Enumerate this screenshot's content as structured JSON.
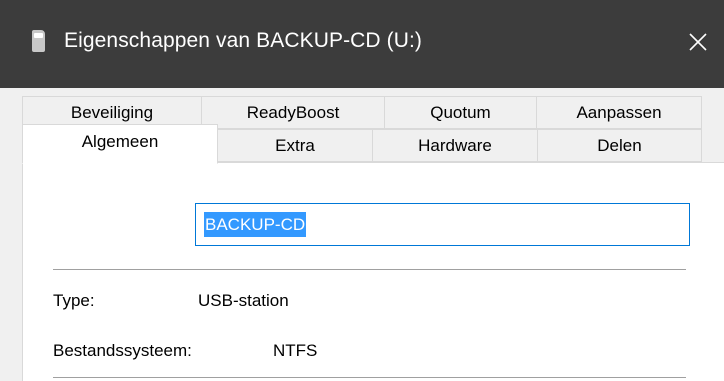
{
  "window": {
    "title": "Eigenschappen van BACKUP-CD (U:)",
    "close_glyph": "✕"
  },
  "tabs": {
    "row_back": [
      "Beveiliging",
      "ReadyBoost",
      "Quotum",
      "Aanpassen"
    ],
    "row_front": [
      "Algemeen",
      "Extra",
      "Hardware",
      "Delen"
    ],
    "selected": "Algemeen"
  },
  "general": {
    "name_value": "BACKUP-CD",
    "type_label": "Type:",
    "type_value": "USB-station",
    "fs_label": "Bestandssysteem:",
    "fs_value": "NTFS"
  },
  "colors": {
    "titlebar": "#3c3c3c",
    "dialog_bg": "#f0f0f0",
    "focus_border": "#0078d7",
    "selection": "#3399ff"
  },
  "icons": {
    "titlebar": "drive-icon",
    "close": "close-icon"
  }
}
